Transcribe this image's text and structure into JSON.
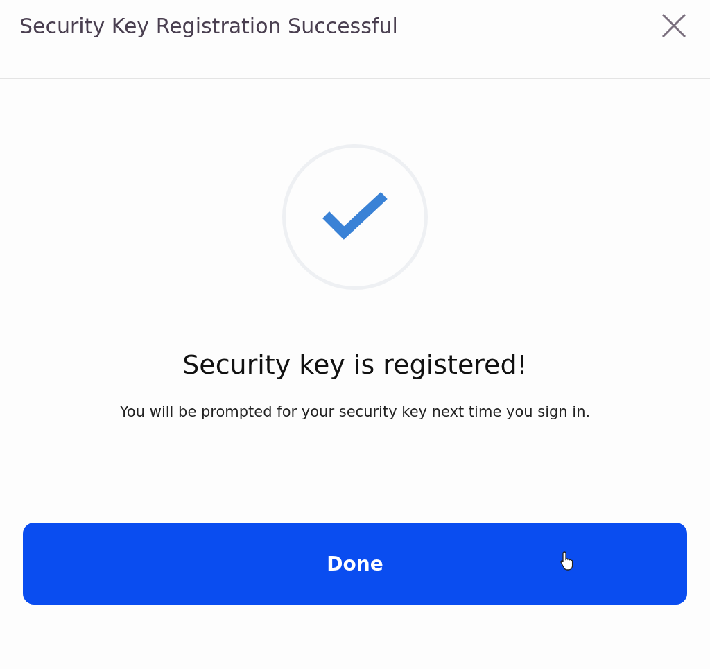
{
  "dialog": {
    "title": "Security Key Registration Successful",
    "heading": "Security key is registered!",
    "message": "You will be prompted for your security key next time you sign in.",
    "button": "Done"
  }
}
